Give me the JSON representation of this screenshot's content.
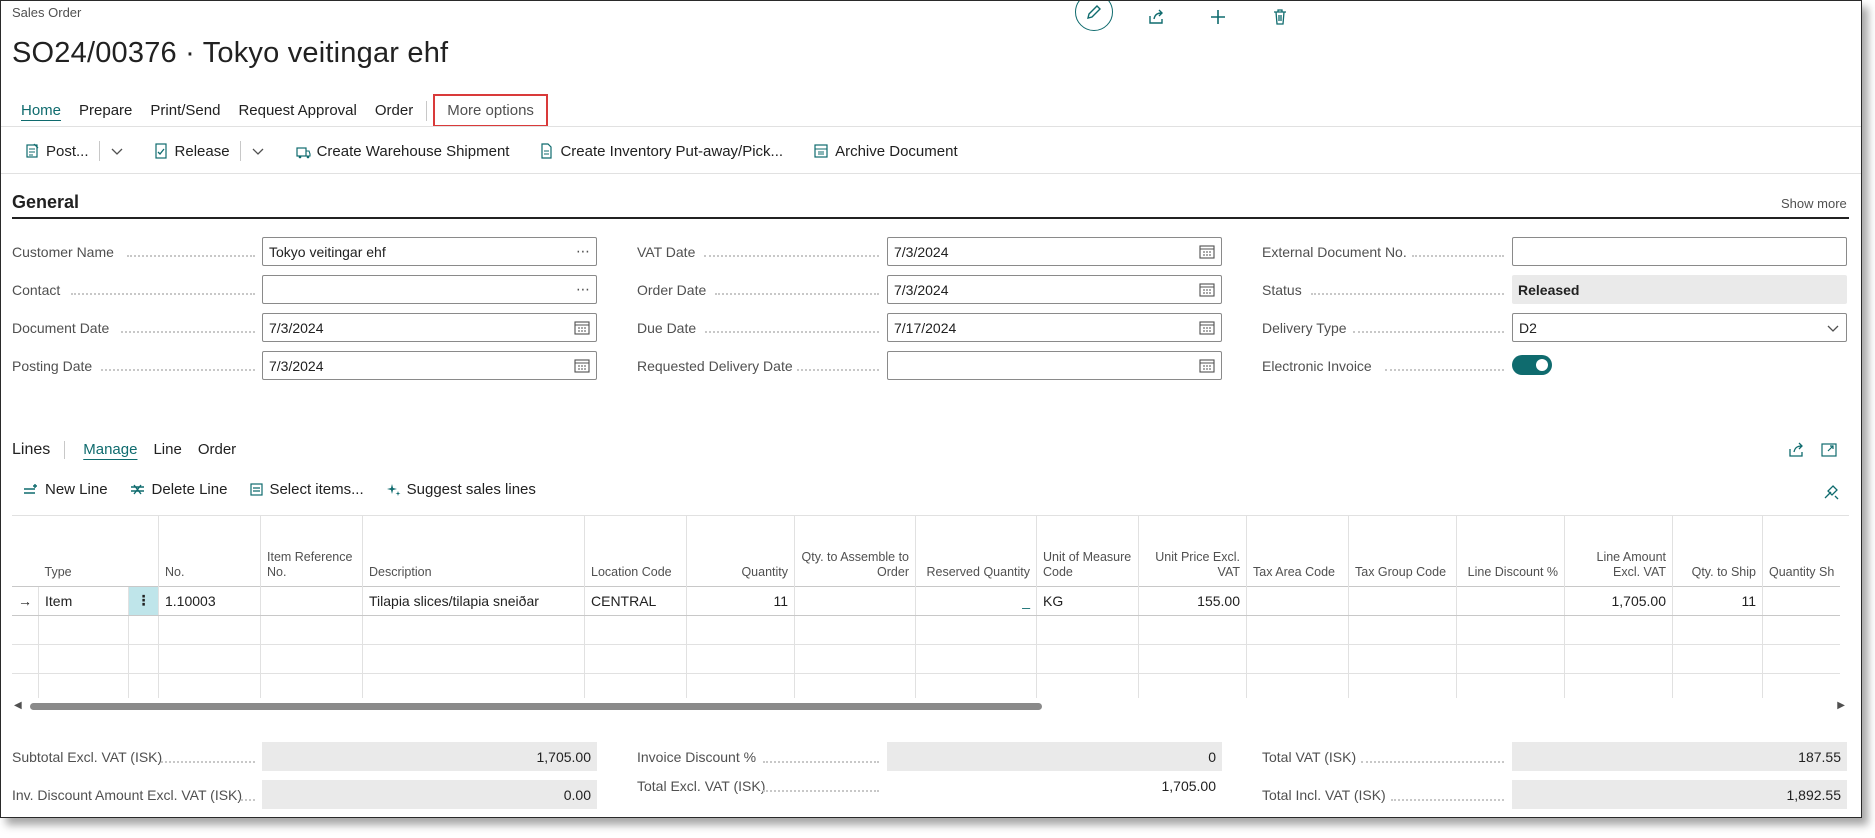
{
  "page": {
    "type_label": "Sales Order",
    "title": "SO24/00376 · Tokyo veitingar ehf"
  },
  "top_actions": {
    "icons": [
      "edit-icon",
      "share-icon",
      "add-icon",
      "delete-icon"
    ]
  },
  "menu": {
    "items": [
      "Home",
      "Prepare",
      "Print/Send",
      "Request Approval",
      "Order"
    ],
    "more": "More options"
  },
  "actions": {
    "post": "Post...",
    "release": "Release",
    "create_warehouse_shipment": "Create Warehouse Shipment",
    "create_inventory_putaway": "Create Inventory Put-away/Pick...",
    "archive_document": "Archive Document"
  },
  "general": {
    "title": "General",
    "show_more": "Show more",
    "fields": {
      "customer_name": {
        "label": "Customer Name",
        "value": "Tokyo veitingar ehf"
      },
      "contact": {
        "label": "Contact",
        "value": ""
      },
      "document_date": {
        "label": "Document Date",
        "value": "7/3/2024"
      },
      "posting_date": {
        "label": "Posting Date",
        "value": "7/3/2024"
      },
      "vat_date": {
        "label": "VAT Date",
        "value": "7/3/2024"
      },
      "order_date": {
        "label": "Order Date",
        "value": "7/3/2024"
      },
      "due_date": {
        "label": "Due Date",
        "value": "7/17/2024"
      },
      "requested_delivery_date": {
        "label": "Requested Delivery Date",
        "value": ""
      },
      "external_document_no": {
        "label": "External Document No.",
        "value": ""
      },
      "status": {
        "label": "Status",
        "value": "Released"
      },
      "delivery_type": {
        "label": "Delivery Type",
        "value": "D2"
      },
      "electronic_invoice": {
        "label": "Electronic Invoice",
        "value": "on"
      }
    }
  },
  "lines": {
    "title": "Lines",
    "tabs": [
      "Manage",
      "Line",
      "Order"
    ],
    "actions": {
      "new_line": "New Line",
      "delete_line": "Delete Line",
      "select_items": "Select items...",
      "suggest_sales_lines": "Suggest sales lines"
    },
    "columns": {
      "type": "Type",
      "no": "No.",
      "item_ref": "Item Reference No.",
      "description": "Description",
      "location": "Location Code",
      "quantity": "Quantity",
      "qty_assemble": "Qty. to Assemble to Order",
      "reserved": "Reserved Quantity",
      "uom": "Unit of Measure Code",
      "unit_price": "Unit Price Excl. VAT",
      "tax_area": "Tax Area Code",
      "tax_group": "Tax Group Code",
      "line_discount": "Line Discount %",
      "line_amount": "Line Amount Excl. VAT",
      "qty_ship": "Qty. to Ship",
      "qty_shipped": "Quantity Sh"
    },
    "rows": [
      {
        "indicator": "→",
        "type": "Item",
        "menu": "⋮",
        "no": "1.10003",
        "item_ref": "",
        "description": "Tilapia slices/tilapia sneiðar",
        "location": "CENTRAL",
        "quantity": "11",
        "qty_assemble": "",
        "reserved": "_",
        "uom": "KG",
        "unit_price": "155.00",
        "tax_area": "",
        "tax_group": "",
        "line_discount": "",
        "line_amount": "1,705.00",
        "qty_ship": "11",
        "qty_shipped": ""
      }
    ]
  },
  "totals": {
    "subtotal": {
      "label": "Subtotal Excl. VAT (ISK)",
      "value": "1,705.00"
    },
    "inv_discount_amount": {
      "label": "Inv. Discount Amount Excl. VAT (ISK)",
      "value": "0.00"
    },
    "invoice_discount_pct": {
      "label": "Invoice Discount %",
      "value": "0"
    },
    "total_excl_vat": {
      "label": "Total Excl. VAT (ISK)",
      "value": "1,705.00"
    },
    "total_vat": {
      "label": "Total VAT (ISK)",
      "value": "187.55"
    },
    "total_incl_vat": {
      "label": "Total Incl. VAT (ISK)",
      "value": "1,892.55"
    }
  },
  "colors": {
    "accent": "#0f6b6e",
    "highlight_border": "#d93a3a",
    "readonly_bg": "#eaeaea",
    "row_menu_bg": "#bfe5ea"
  }
}
